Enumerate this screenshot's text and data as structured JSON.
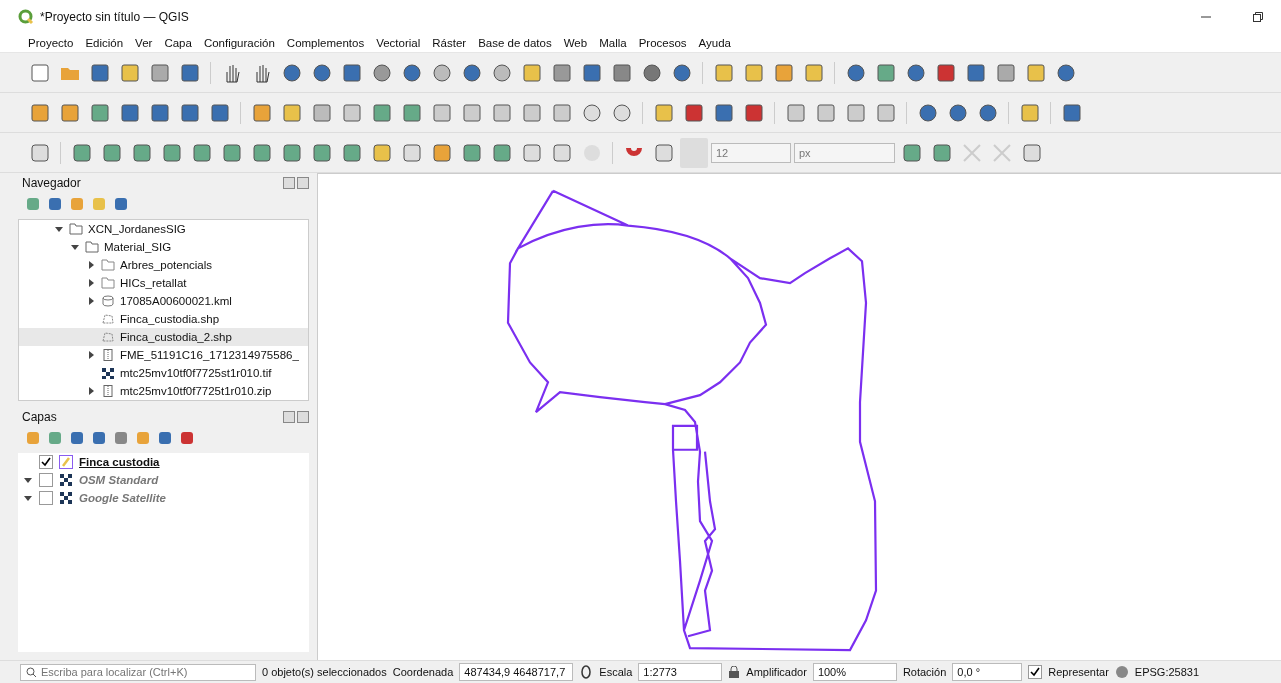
{
  "window": {
    "title": "*Proyecto sin título — QGIS"
  },
  "menu": [
    "Proyecto",
    "Edición",
    "Ver",
    "Capa",
    "Configuración",
    "Complementos",
    "Vectorial",
    "Ráster",
    "Base de datos",
    "Web",
    "Malla",
    "Procesos",
    "Ayuda"
  ],
  "snapping": {
    "tolerance": "12",
    "unit": "px"
  },
  "browser": {
    "title": "Navegador",
    "tree": [
      {
        "label": "XCN_JordanesSIG",
        "expanded": true,
        "children": [
          {
            "label": "Material_SIG",
            "expanded": true,
            "children": [
              {
                "label": "Arbres_potencials",
                "kind": "folder",
                "expanded": false,
                "selected": false
              },
              {
                "label": "HICs_retallat",
                "kind": "folder",
                "expanded": false,
                "selected": false
              },
              {
                "label": "17085A00600021.kml",
                "kind": "database",
                "expanded": false,
                "selected": false
              },
              {
                "label": "Finca_custodia.shp",
                "kind": "vector",
                "selected": false
              },
              {
                "label": "Finca_custodia_2.shp",
                "kind": "vector",
                "selected": true
              },
              {
                "label": "FME_51191C16_1712314975586_",
                "kind": "archive",
                "expanded": false,
                "selected": false
              },
              {
                "label": "mtc25mv10tf0f7725st1r010.tif",
                "kind": "raster",
                "selected": false
              },
              {
                "label": "mtc25mv10tf0f7725t1r010.zip",
                "kind": "archive",
                "expanded": false,
                "selected": false
              }
            ]
          }
        ]
      }
    ]
  },
  "layers": {
    "title": "Capas",
    "items": [
      {
        "label": "Finca custodia",
        "kind": "vector",
        "checked": true
      },
      {
        "label": "OSM Standard",
        "kind": "raster",
        "checked": false,
        "expanded": true
      },
      {
        "label": "Google Satellite",
        "kind": "raster",
        "checked": false,
        "expanded": true
      }
    ]
  },
  "status_bar": {
    "search_placeholder": "Escriba para localizar (Ctrl+K)",
    "selection": "0 objeto(s) seleccionados",
    "coordinate_label": "Coordenada",
    "coordinate": "487434,9  4648717,7",
    "scale_label": "Escala",
    "scale": "1:2773",
    "magnifier_label": "Amplificador",
    "magnifier": "100%",
    "rotation_label": "Rotación",
    "rotation": "0,0 °",
    "render_checked": true,
    "render_label": "Representar",
    "crs": "EPSG:25831"
  }
}
